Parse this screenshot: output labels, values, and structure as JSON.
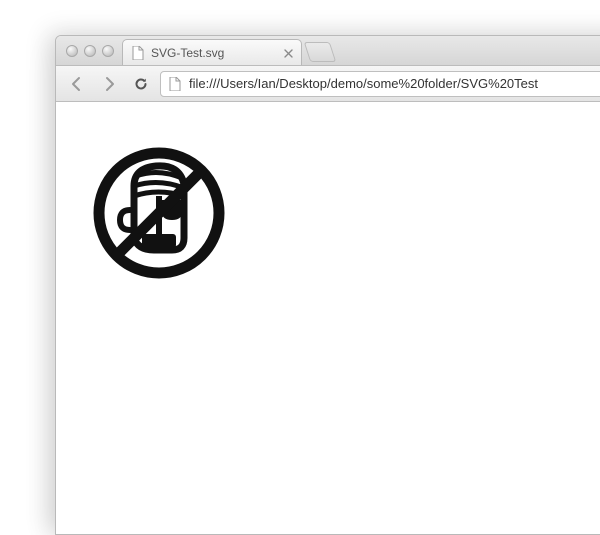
{
  "tab": {
    "title": "SVG-Test.svg",
    "favicon_name": "file-icon"
  },
  "toolbar": {
    "url": "file:///Users/Ian/Desktop/demo/some%20folder/SVG%20Test"
  },
  "content": {
    "svg_name": "no-piracy-icon"
  },
  "colors": {
    "chrome_bg": "#e4e4e4",
    "icon_black": "#111111"
  }
}
